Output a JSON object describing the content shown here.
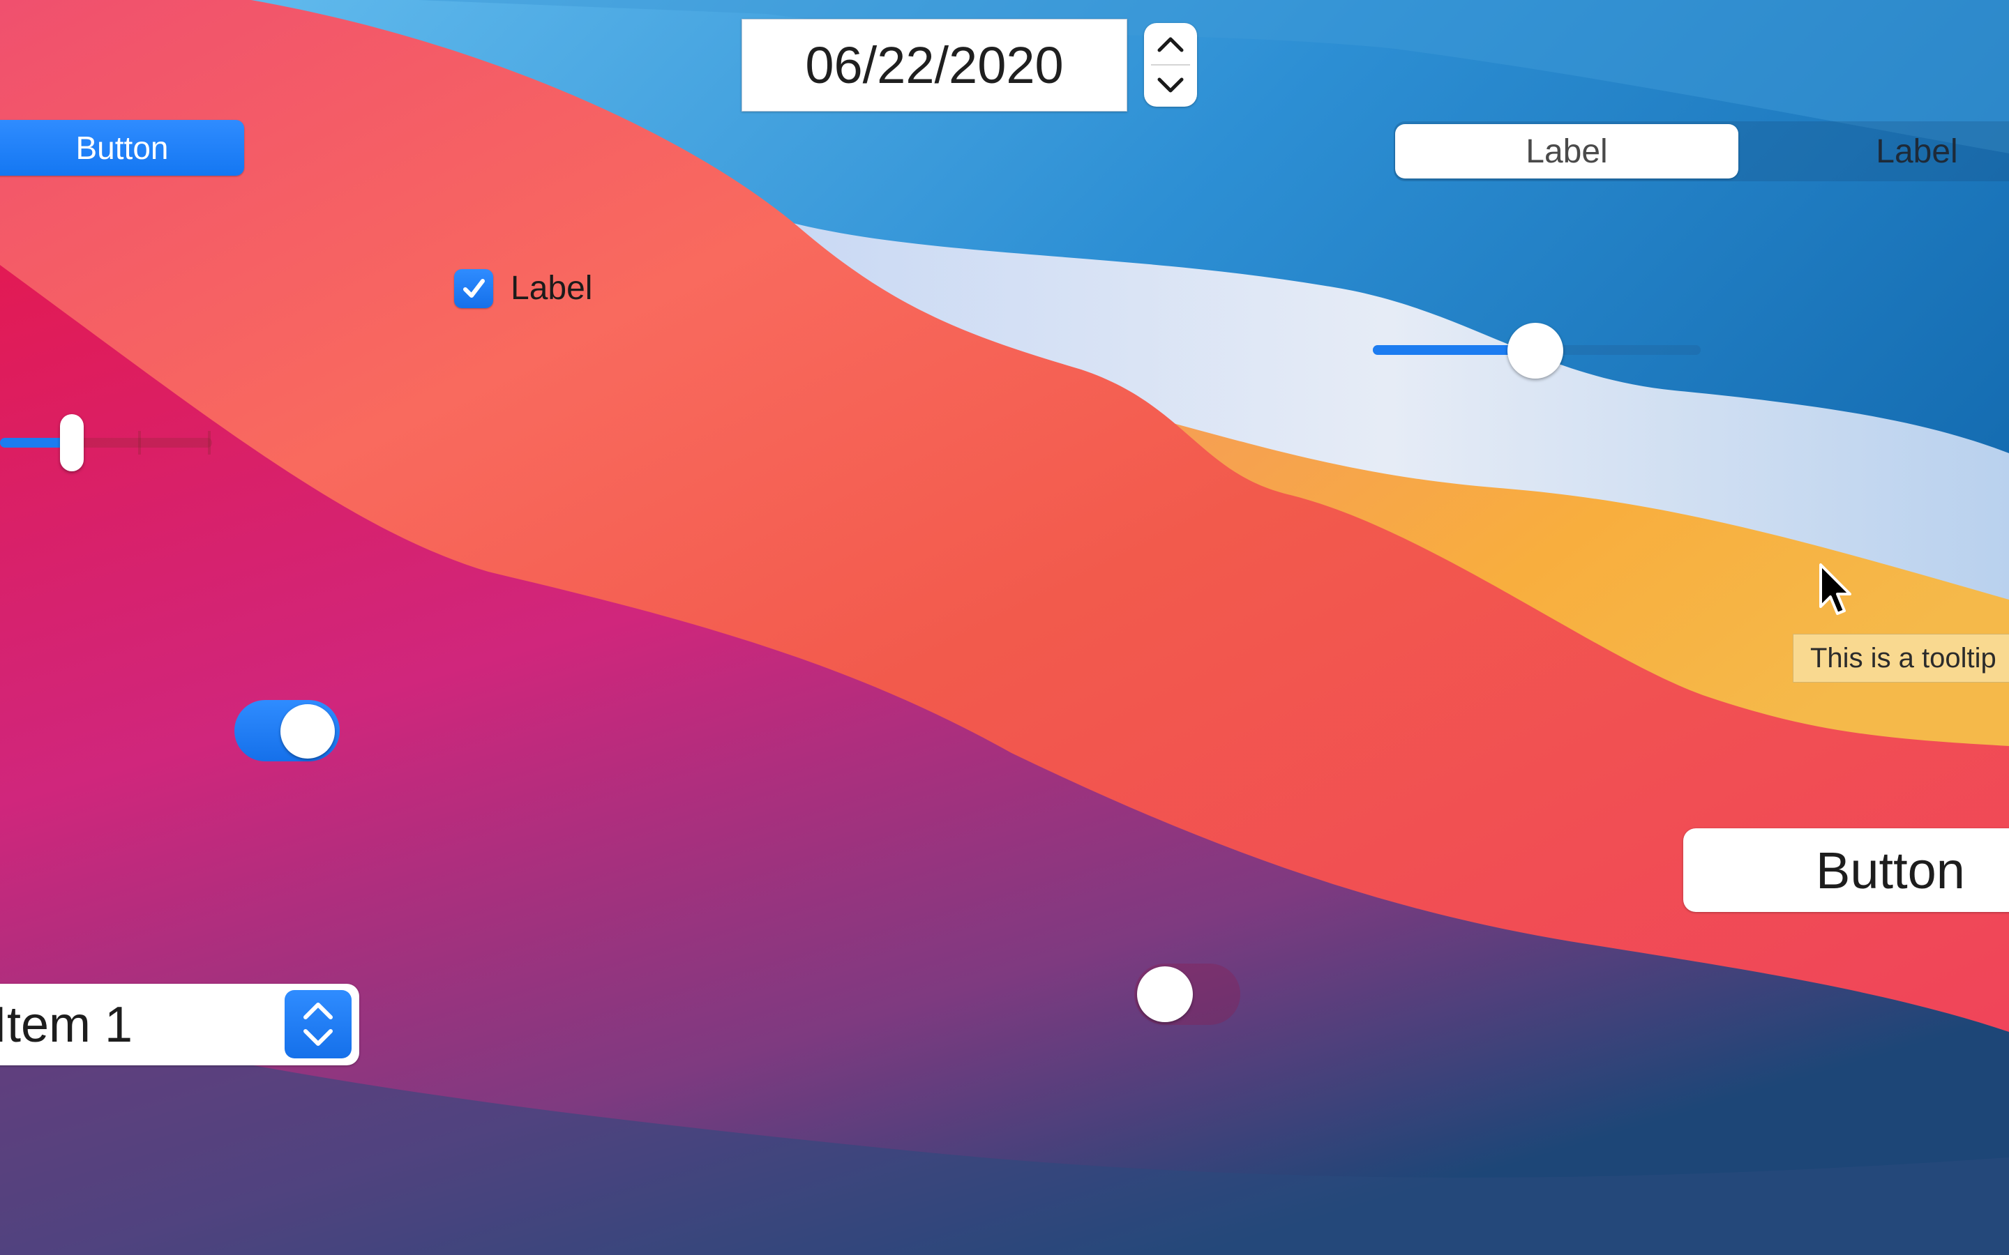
{
  "colors": {
    "accent": "#1c7cf0",
    "tooltip_bg": "#f9d990",
    "control_bg": "#ffffff"
  },
  "date_picker": {
    "value": "06/22/2020",
    "stepper_up_icon": "chevron-up-icon",
    "stepper_down_icon": "chevron-down-icon"
  },
  "blue_button": {
    "label": "Button"
  },
  "segmented_control": {
    "segments": [
      {
        "label": "Label",
        "selected": true
      },
      {
        "label": "Label",
        "selected": false
      }
    ]
  },
  "checkbox": {
    "label": "Label",
    "checked": true,
    "icon": "checkmark-icon"
  },
  "slider": {
    "value": 0.5
  },
  "ticked_slider": {
    "value": 0.33
  },
  "toggle_on": {
    "on": true
  },
  "toggle_off": {
    "on": false
  },
  "tooltip": {
    "text": "This is a tooltip"
  },
  "white_button": {
    "label": "Button"
  },
  "popup_button": {
    "value": "Item 1",
    "icon": "chevron-up-down-icon"
  },
  "cursor": {
    "icon": "arrow-cursor-icon"
  }
}
